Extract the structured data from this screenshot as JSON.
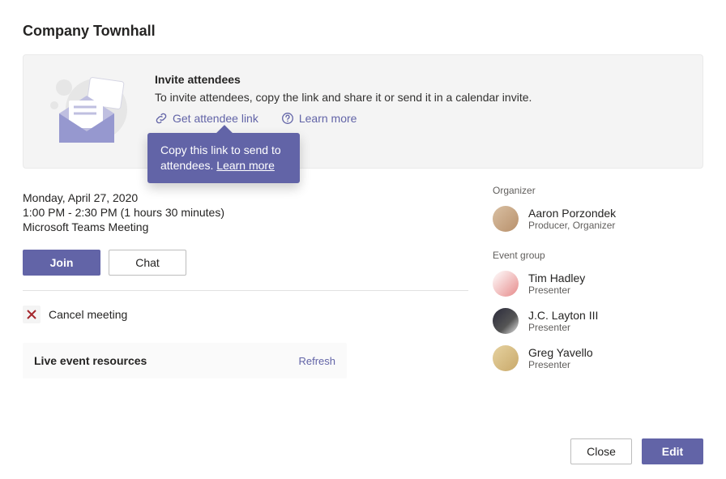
{
  "title": "Company Townhall",
  "invite": {
    "heading": "Invite attendees",
    "body": "To invite attendees, copy the link and share it or send it in a calendar invite.",
    "get_link": "Get attendee link",
    "learn_more": "Learn more"
  },
  "tooltip": {
    "line1": "Copy this link to send to",
    "line2_prefix": "attendees. ",
    "learn_more": "Learn more"
  },
  "meeting": {
    "date": "Monday, April 27, 2020",
    "time": "1:00 PM - 2:30 PM (1 hours 30 minutes)",
    "location": "Microsoft Teams Meeting"
  },
  "buttons": {
    "join": "Join",
    "chat": "Chat",
    "close": "Close",
    "edit": "Edit"
  },
  "cancel_label": "Cancel meeting",
  "resources": {
    "label": "Live event resources",
    "refresh": "Refresh"
  },
  "organizer": {
    "section": "Organizer",
    "name": "Aaron Porzondek",
    "role": "Producer, Organizer"
  },
  "event_group": {
    "section": "Event group",
    "people": [
      {
        "name": "Tim Hadley",
        "role": "Presenter"
      },
      {
        "name": "J.C. Layton III",
        "role": "Presenter"
      },
      {
        "name": "Greg Yavello",
        "role": "Presenter"
      }
    ]
  }
}
